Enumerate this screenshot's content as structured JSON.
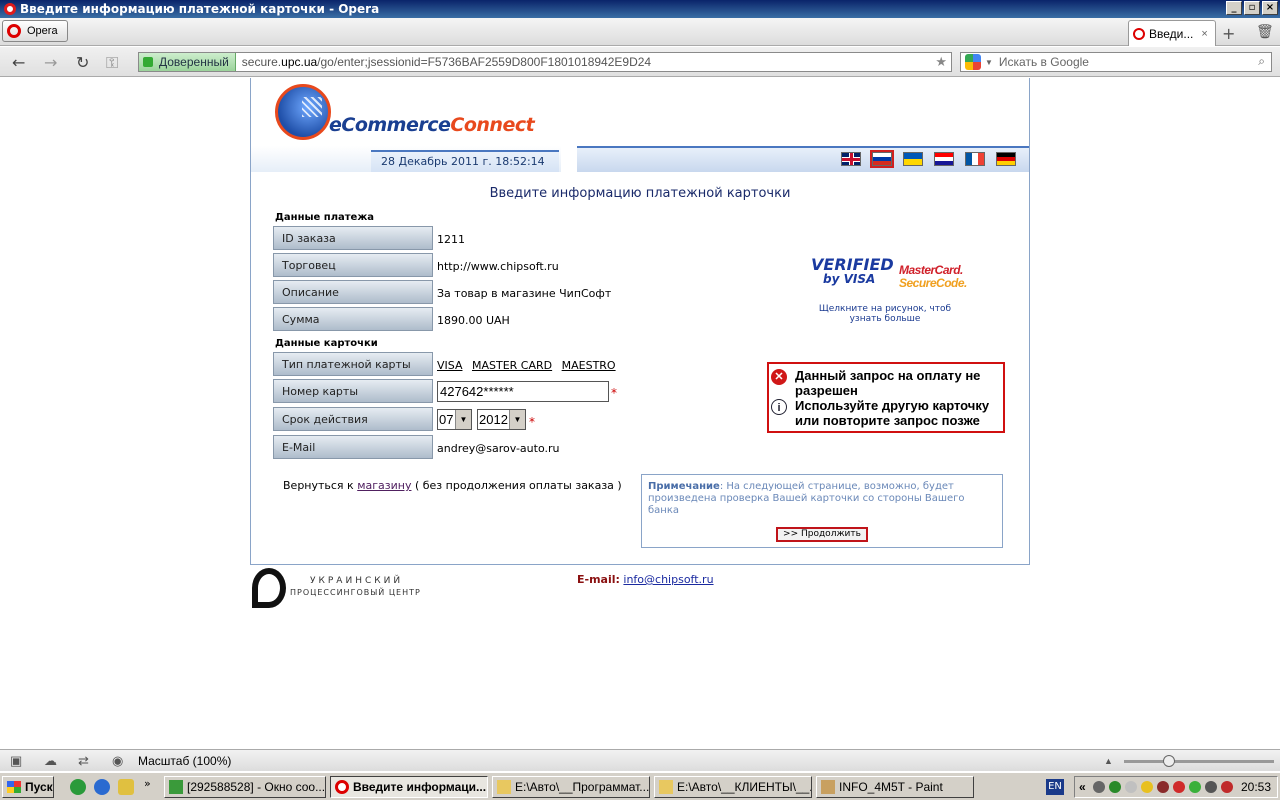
{
  "window": {
    "title": "Введите информацию платежной карточки - Opera",
    "controls": [
      "_",
      "▫",
      "×"
    ]
  },
  "browser": {
    "menu_label": "Opera",
    "active_tab": "Введи...",
    "tab_close": "×",
    "new_tab": "+",
    "trash": "🗑",
    "security_label": "Доверенный",
    "url_prefix": "secure.",
    "url_domain": "upc.ua",
    "url_rest": "/go/enter;jsessionid=F5736BAF2559D800F1801018942E9D24",
    "search_placeholder": "Искать в Google",
    "nav_icons": [
      "arrow-left-icon",
      "arrow-right-icon",
      "reload-icon",
      "key-icon"
    ]
  },
  "page": {
    "logo_text_blue": "eCommerce",
    "logo_text_orange": "Connect",
    "datetime": "28 Декабрь 2011 г. 18:52:14",
    "flags": [
      {
        "name": "flag-uk",
        "colors": [
          "#012169",
          "#ffffff",
          "#c8102e"
        ]
      },
      {
        "name": "flag-ru",
        "colors": [
          "#ffffff",
          "#0039a6",
          "#d52b1e"
        ]
      },
      {
        "name": "flag-ua",
        "colors": [
          "#0057b7",
          "#ffd700"
        ]
      },
      {
        "name": "flag-hr",
        "colors": [
          "#ff0000",
          "#ffffff",
          "#171796"
        ]
      },
      {
        "name": "flag-fr",
        "colors": [
          "#0055a4",
          "#ffffff",
          "#ef4135"
        ]
      },
      {
        "name": "flag-de",
        "colors": [
          "#000000",
          "#dd0000",
          "#ffce00"
        ]
      }
    ],
    "title": "Введите информацию платежной карточки",
    "payment_section": "Данные платежа",
    "payment_rows": [
      {
        "label": "ID заказа",
        "value": "1211"
      },
      {
        "label": "Торговец",
        "value": "http://www.chipsoft.ru"
      },
      {
        "label": "Описание",
        "value": "За товар в магазине ЧипСофт"
      },
      {
        "label": "Сумма",
        "value": "1890.00 UAH"
      }
    ],
    "card_section": "Данные карточки",
    "card_type_label": "Тип платежной карты",
    "card_types": [
      "VISA",
      "MASTER CARD",
      "MAESTRO"
    ],
    "card_number_label": "Номер карты",
    "card_number_value": "427642******",
    "expiry_label": "Срок действия",
    "expiry_month": "07",
    "expiry_year": "2012",
    "email_label": "E-Mail",
    "email_value": "andrey@sarov-auto.ru",
    "required_mark": "*",
    "back_prefix": "Вернуться к",
    "back_link": "магазину",
    "back_suffix": "( без продолжения оплаты заказа )",
    "note_label": "Примечание",
    "note_text": ": На следующей странице, возможно, будет произведена проверка Вашей карточки со стороны Вашего банка",
    "continue_button": ">> Продолжить",
    "verified_visa_1": "VERIFIED",
    "verified_visa_2": "by VISA",
    "mastercard_1": "MasterCard.",
    "mastercard_2": "SecureCode.",
    "secure_caption": "Щелкните на рисунок, чтоб узнать больше",
    "error_message": "Данный запрос на оплату не разрешен",
    "info_message": "Используйте другую карточку или повторите запрос позже",
    "footer_logo_line1": "УКРАИНСКИЙ",
    "footer_logo_line2": "ПРОЦЕССИНГОВЫЙ ЦЕНТР",
    "footer_email_label": "E-mail:",
    "footer_email": "info@chipsoft.ru"
  },
  "statusbar": {
    "zoom_text": "Масштаб (100%)",
    "zoom_level": 0.3
  },
  "taskbar": {
    "start": "Пуск",
    "tasks": [
      {
        "label": "[292588528] - Окно соо...",
        "active": false
      },
      {
        "label": "Введите информаци...",
        "active": true
      },
      {
        "label": "E:\\Авто\\__Программат...",
        "active": false
      },
      {
        "label": "E:\\Авто\\__КЛИЕНТЫ\\__...",
        "active": false
      },
      {
        "label": "INFO_4M5T - Paint",
        "active": false
      }
    ],
    "lang": "EN",
    "tray_expand": "«",
    "clock": "20:53"
  }
}
